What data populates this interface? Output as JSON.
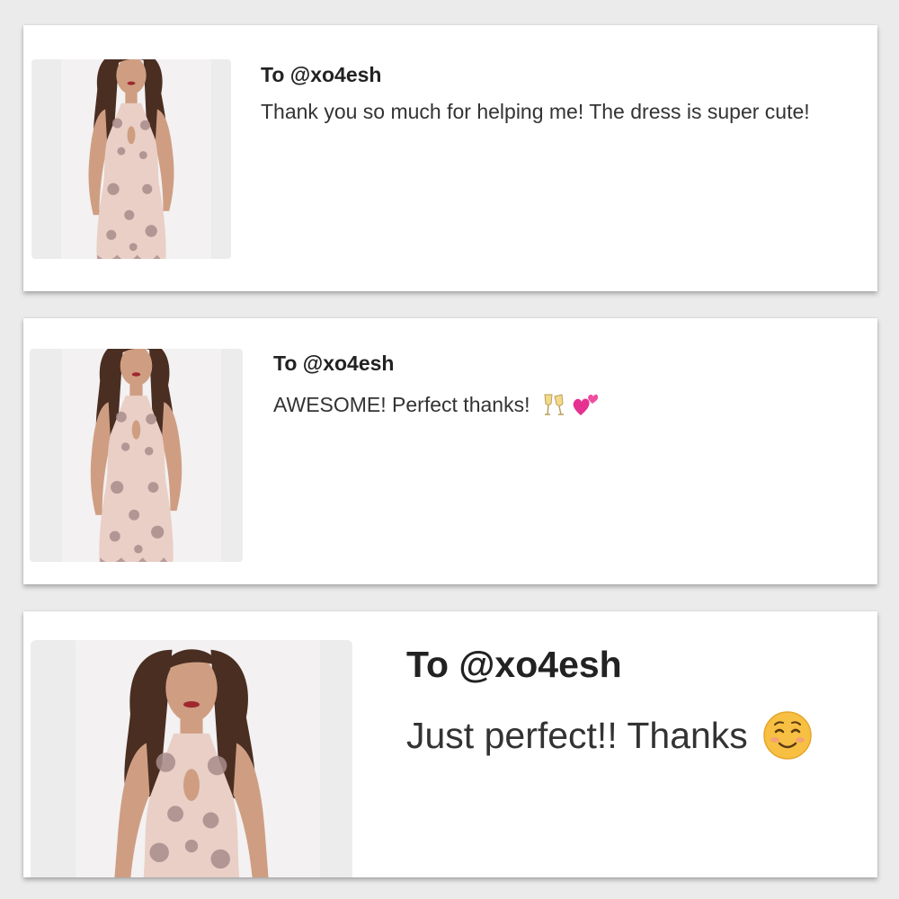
{
  "reviews": [
    {
      "recipient": "To @xo4esh",
      "message": "Thank you so much for helping me! The dress is super cute!",
      "image": "product-photo-sequin-halter-dress"
    },
    {
      "recipient": "To @xo4esh",
      "message": "AWESOME! Perfect thanks!",
      "emojis": [
        "clinking-glasses-icon",
        "two-hearts-icon"
      ],
      "image": "product-photo-sequin-halter-dress"
    },
    {
      "recipient": "To @xo4esh",
      "message": "Just perfect!! Thanks",
      "emojis": [
        "smiling-face-icon"
      ],
      "image": "product-photo-sequin-halter-dress"
    }
  ],
  "colors": {
    "background": "#ebebeb",
    "card": "#ffffff",
    "dress": "#e9cfc6",
    "sequin": "#a88d8c",
    "hair": "#4a2e22",
    "skin": "#cf9e82"
  }
}
